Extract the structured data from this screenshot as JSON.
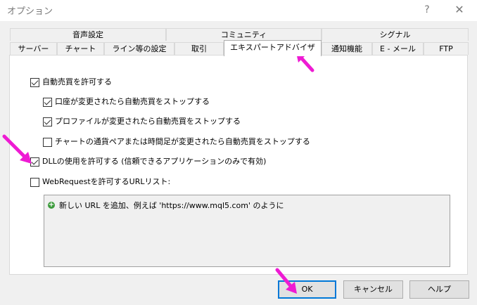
{
  "window": {
    "title": "オプション",
    "help_glyph": "?",
    "close_glyph": "✕"
  },
  "tabs": {
    "top_row": [
      "音声設定",
      "コミュニティ",
      "シグナル"
    ],
    "bottom_row": [
      "サーバー",
      "チャート",
      "ライン等の設定",
      "取引",
      "エキスパートアドバイザ",
      "通知機能",
      "E - メール",
      "FTP"
    ],
    "active": "エキスパートアドバイザ"
  },
  "options": {
    "allow_auto_trading": {
      "label": "自動売買を許可する",
      "checked": true
    },
    "stop_on_account_change": {
      "label": "口座が変更されたら自動売買をストップする",
      "checked": true
    },
    "stop_on_profile_change": {
      "label": "プロファイルが変更されたら自動売買をストップする",
      "checked": true
    },
    "stop_on_chart_change": {
      "label": "チャートの通貨ペアまたは時間足が変更されたら自動売買をストップする",
      "checked": false
    },
    "allow_dll": {
      "label": "DLLの使用を許可する (信頼できるアプリケーションのみで有効)",
      "checked": true
    },
    "allow_webrequest": {
      "label": "WebRequestを許可するURLリスト:",
      "checked": false
    }
  },
  "url_list": {
    "add_hint": "新しい URL を追加、例えば 'https://www.mql5.com' のように"
  },
  "buttons": {
    "ok": "OK",
    "cancel": "キャンセル",
    "help": "ヘルプ"
  },
  "colors": {
    "annotation_arrow": "#ee1bd3",
    "default_button_border": "#0078d7"
  },
  "icons": {
    "add_url": "plus-circle-icon",
    "annotation": "pink-arrow-icon"
  }
}
